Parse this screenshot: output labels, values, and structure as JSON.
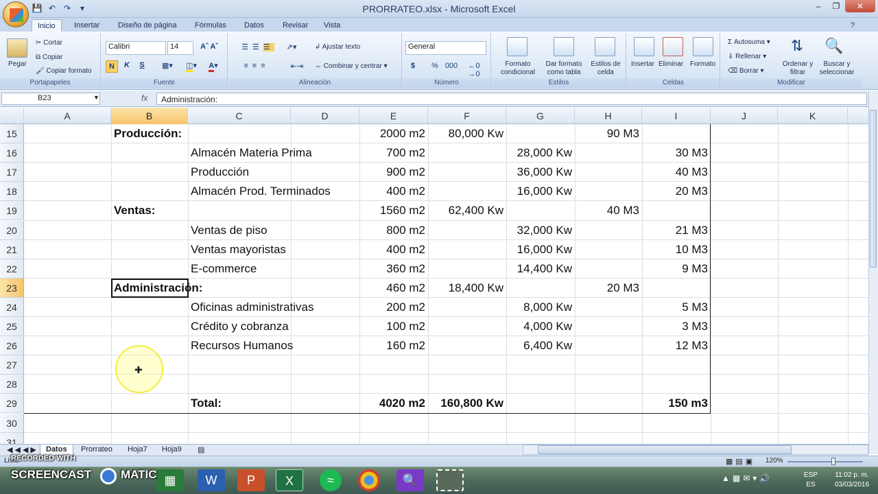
{
  "window": {
    "title": "PRORRATEO.xlsx - Microsoft Excel"
  },
  "ribbon_tabs": [
    "Inicio",
    "Insertar",
    "Diseño de página",
    "Fórmulas",
    "Datos",
    "Revisar",
    "Vista"
  ],
  "ribbon": {
    "clipboard": {
      "paste": "Pegar",
      "cut": "Cortar",
      "copy": "Copiar",
      "format_painter": "Copiar formato",
      "label": "Portapapeles"
    },
    "font": {
      "family": "Calibri",
      "size": "14",
      "bold": "N",
      "italic": "K",
      "underline": "S",
      "label": "Fuente"
    },
    "alignment": {
      "wrap": "Ajustar texto",
      "merge": "Combinar y centrar",
      "label": "Alineación"
    },
    "number": {
      "format": "General",
      "currency": "$",
      "percent": "%",
      "thousands": "000",
      "label": "Número"
    },
    "styles": {
      "conditional": "Formato condicional",
      "table": "Dar formato como tabla",
      "cell_styles": "Estilos de celda",
      "label": "Estilos"
    },
    "cells": {
      "insert": "Insertar",
      "delete": "Eliminar",
      "format": "Formato",
      "label": "Celdas"
    },
    "editing": {
      "autosum": "Autosuma",
      "fill": "Rellenar",
      "clear": "Borrar",
      "sort": "Ordenar y filtrar",
      "find": "Buscar y seleccionar",
      "label": "Modificar"
    }
  },
  "formula_bar": {
    "name_box": "B23",
    "fx": "fx",
    "content": "Administración:"
  },
  "columns": [
    "A",
    "B",
    "C",
    "D",
    "E",
    "F",
    "G",
    "H",
    "I",
    "J",
    "K"
  ],
  "rows": [
    {
      "n": "15",
      "B": "Producción:",
      "C": "",
      "E": "2000 m2",
      "F": "80,000 Kw",
      "G": "",
      "H": "90 M3",
      "I": ""
    },
    {
      "n": "16",
      "B": "",
      "C": "Almacén Materia Prima",
      "E": "700 m2",
      "F": "",
      "G": "28,000 Kw",
      "H": "",
      "I": "30 M3"
    },
    {
      "n": "17",
      "B": "",
      "C": "Producción",
      "E": "900 m2",
      "F": "",
      "G": "36,000 Kw",
      "H": "",
      "I": "40 M3"
    },
    {
      "n": "18",
      "B": "",
      "C": "Almacén Prod. Terminados",
      "E": "400 m2",
      "F": "",
      "G": "16,000 Kw",
      "H": "",
      "I": "20 M3"
    },
    {
      "n": "19",
      "B": "Ventas:",
      "C": "",
      "E": "1560 m2",
      "F": "62,400 Kw",
      "G": "",
      "H": "40 M3",
      "I": ""
    },
    {
      "n": "20",
      "B": "",
      "C": "Ventas de piso",
      "E": "800 m2",
      "F": "",
      "G": "32,000 Kw",
      "H": "",
      "I": "21 M3"
    },
    {
      "n": "21",
      "B": "",
      "C": "Ventas mayoristas",
      "E": "400 m2",
      "F": "",
      "G": "16,000 Kw",
      "H": "",
      "I": "10 M3"
    },
    {
      "n": "22",
      "B": "",
      "C": "E-commerce",
      "E": "360 m2",
      "F": "",
      "G": "14,400 Kw",
      "H": "",
      "I": "9 M3"
    },
    {
      "n": "23",
      "B": "Administración:",
      "C": "",
      "E": "460 m2",
      "F": "18,400 Kw",
      "G": "",
      "H": "20 M3",
      "I": ""
    },
    {
      "n": "24",
      "B": "",
      "C": "Oficinas administrativas",
      "E": "200 m2",
      "F": "",
      "G": "8,000 Kw",
      "H": "",
      "I": "5 M3"
    },
    {
      "n": "25",
      "B": "",
      "C": "Crédito y cobranza",
      "E": "100 m2",
      "F": "",
      "G": "4,000 Kw",
      "H": "",
      "I": "3 M3"
    },
    {
      "n": "26",
      "B": "",
      "C": "Recursos Humanos",
      "E": "160 m2",
      "F": "",
      "G": "6,400 Kw",
      "H": "",
      "I": "12 M3"
    },
    {
      "n": "27",
      "B": "",
      "C": "",
      "E": "",
      "F": "",
      "G": "",
      "H": "",
      "I": ""
    },
    {
      "n": "28",
      "B": "",
      "C": "",
      "E": "",
      "F": "",
      "G": "",
      "H": "",
      "I": ""
    },
    {
      "n": "29",
      "B": "",
      "C": "Total:",
      "E": "4020 m2",
      "F": "160,800 Kw",
      "G": "",
      "H": "",
      "I": "150 m3"
    },
    {
      "n": "30",
      "B": "",
      "C": "",
      "E": "",
      "F": "",
      "G": "",
      "H": "",
      "I": ""
    },
    {
      "n": "31",
      "B": "",
      "C": "",
      "E": "",
      "F": "",
      "G": "",
      "H": "",
      "I": ""
    }
  ],
  "sheets": [
    "Datos",
    "Prorrateo",
    "Hoja7",
    "Hoja9"
  ],
  "status": {
    "mode": "Listo",
    "zoom": "120%"
  },
  "watermark": {
    "line1": "RECORDED WITH",
    "line2": "SCREENCAST",
    "line3": "MATIC"
  },
  "taskbar": {
    "lang1": "ESP",
    "lang2": "ES",
    "time": "11:02 p. m.",
    "date": "03/03/2016"
  }
}
